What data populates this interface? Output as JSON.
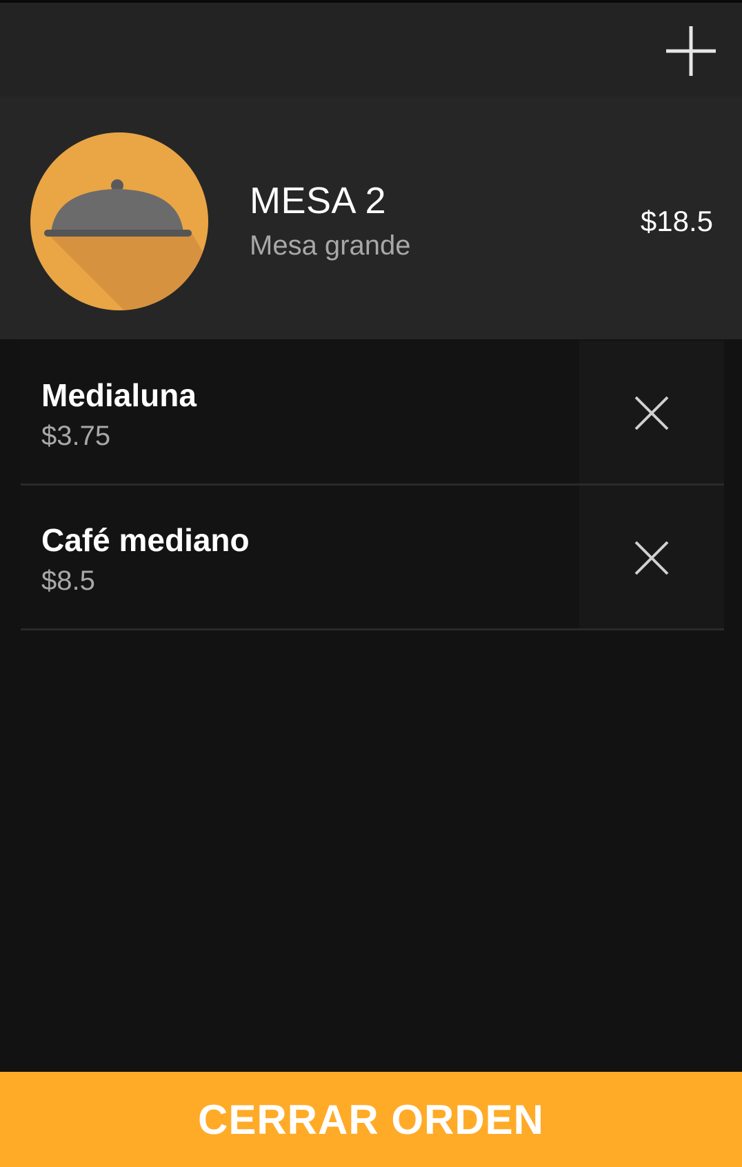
{
  "toolbar": {
    "add_icon": "plus-icon"
  },
  "table": {
    "name": "MESA 2",
    "description": "Mesa grande",
    "total": "$18.5",
    "avatar_icon": "serving-dish-icon"
  },
  "items": [
    {
      "name": "Medialuna",
      "price": "$3.75",
      "remove_icon": "close-icon"
    },
    {
      "name": "Café mediano",
      "price": "$8.5",
      "remove_icon": "close-icon"
    }
  ],
  "actions": {
    "close_order_label": "CERRAR ORDEN"
  },
  "colors": {
    "accent": "#ffab28",
    "avatar_bg": "#eaa545",
    "dish": "#6b6b6b"
  }
}
